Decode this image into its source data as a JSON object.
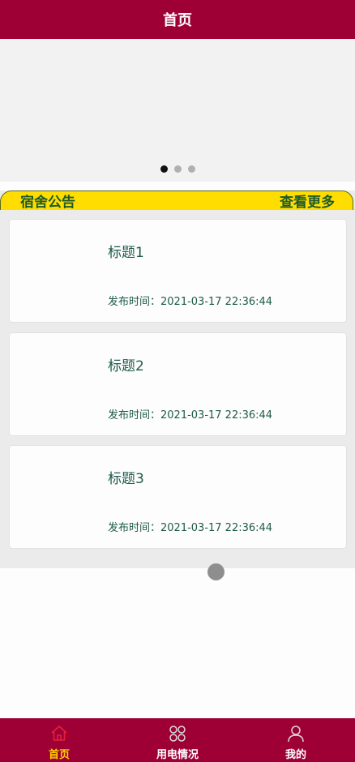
{
  "header": {
    "title": "首页"
  },
  "banner": {
    "dots": 3,
    "active_index": 0
  },
  "notice": {
    "title": "宿舍公告",
    "more_label": "查看更多",
    "items": [
      {
        "title": "标题1",
        "time": "发布时间：2021-03-17 22:36:44"
      },
      {
        "title": "标题2",
        "time": "发布时间：2021-03-17 22:36:44"
      },
      {
        "title": "标题3",
        "time": "发布时间：2021-03-17 22:36:44"
      }
    ]
  },
  "tabbar": {
    "items": [
      {
        "label": "首页",
        "icon": "home-icon",
        "active": true
      },
      {
        "label": "用电情况",
        "icon": "grid-icon",
        "active": false
      },
      {
        "label": "我的",
        "icon": "user-icon",
        "active": false
      }
    ]
  },
  "colors": {
    "primary": "#9e0036",
    "notice_bar": "#ffdd00",
    "notice_text": "#1e5a2a",
    "active_tab": "#ffd200"
  }
}
